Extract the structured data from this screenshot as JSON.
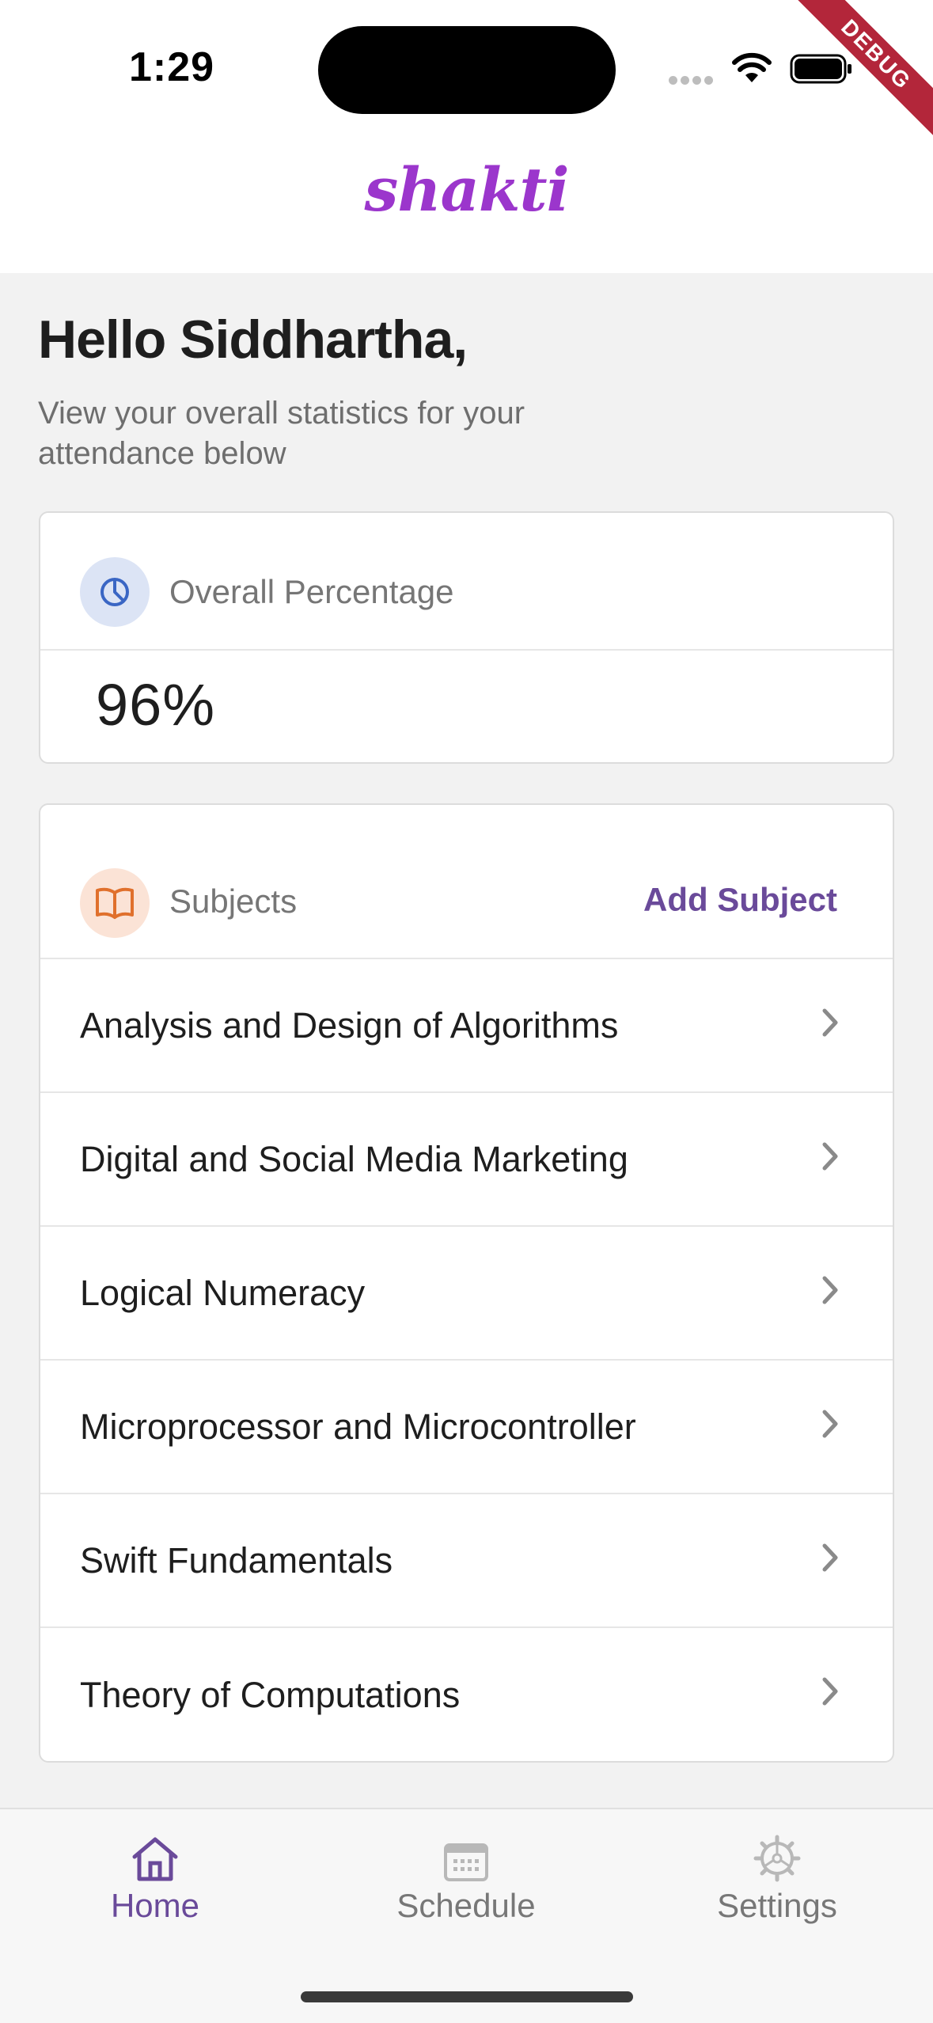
{
  "status_bar": {
    "time": "1:29",
    "debug_label": "DEBUG"
  },
  "app": {
    "logo_text": "shakti",
    "brand_color": "#9b36cc",
    "accent_color": "#6a4a9a"
  },
  "greeting": {
    "title": "Hello Siddhartha,",
    "subtitle": "View your overall statistics for your attendance below"
  },
  "overall": {
    "icon": "pie-chart-icon",
    "label": "Overall Percentage",
    "value": "96%"
  },
  "subjects": {
    "icon": "book-icon",
    "label": "Subjects",
    "add_label": "Add Subject",
    "items": [
      "Analysis and Design of Algorithms",
      "Digital and Social Media Marketing",
      "Logical Numeracy",
      "Microprocessor and Microcontroller",
      "Swift Fundamentals",
      "Theory of Computations"
    ]
  },
  "nav": {
    "items": [
      {
        "label": "Home",
        "icon": "home-icon",
        "active": true
      },
      {
        "label": "Schedule",
        "icon": "calendar-icon",
        "active": false
      },
      {
        "label": "Settings",
        "icon": "gear-icon",
        "active": false
      }
    ]
  }
}
